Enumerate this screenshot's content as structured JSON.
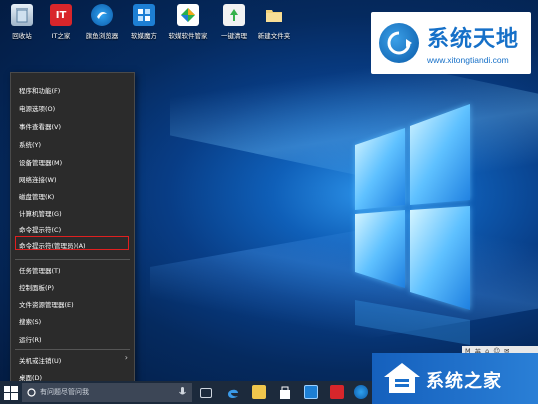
{
  "desktop_icons": [
    {
      "label": "回收站",
      "icon": "recycle-bin-icon"
    },
    {
      "label": "IT之家",
      "icon": "ithome-icon",
      "badge": "IT"
    },
    {
      "label": "旗鱼浏览器",
      "icon": "browser-icon"
    },
    {
      "label": "软媒魔方",
      "icon": "cube-icon"
    },
    {
      "label": "软媒软件管家",
      "icon": "software-manager-icon"
    },
    {
      "label": "一键清理",
      "icon": "cleanup-icon"
    },
    {
      "label": "新建文件夹",
      "icon": "folder-icon"
    }
  ],
  "watermark_top": {
    "title": "系统天地",
    "url": "www.xitongtiandi.com"
  },
  "context_menu": {
    "items": [
      {
        "label": "程序和功能(F)"
      },
      {
        "label": "电源选项(O)"
      },
      {
        "label": "事件查看器(V)"
      },
      {
        "label": "系统(Y)"
      },
      {
        "label": "设备管理器(M)"
      },
      {
        "label": "网络连接(W)"
      },
      {
        "label": "磁盘管理(K)"
      },
      {
        "label": "计算机管理(G)"
      },
      {
        "label": "命令提示符(C)"
      },
      {
        "label": "命令提示符(管理员)(A)",
        "highlighted": true
      },
      {
        "label": "任务管理器(T)"
      },
      {
        "label": "控制面板(P)"
      },
      {
        "label": "文件资源管理器(E)"
      },
      {
        "label": "搜索(S)"
      },
      {
        "label": "运行(R)"
      },
      {
        "label": "关机或注销(U)",
        "submenu": true
      },
      {
        "label": "桌面(D)"
      }
    ],
    "highlight_color": "#e02020"
  },
  "taskbar": {
    "search_placeholder": "有问题尽管问我",
    "apps": [
      "task-view-icon",
      "edge-icon",
      "file-explorer-icon",
      "store-icon",
      "app-icon",
      "ithome-icon",
      "browser-icon"
    ]
  },
  "watermark_bottom": {
    "title": "系统之家"
  },
  "tray": {
    "items": [
      "M",
      "英",
      "⌂",
      "☺",
      "✉"
    ]
  }
}
